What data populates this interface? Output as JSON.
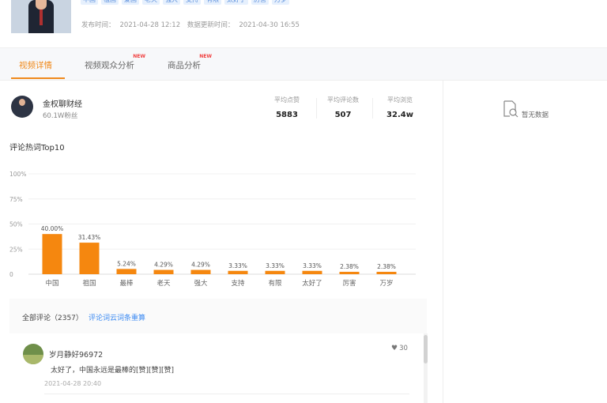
{
  "video": {
    "tags": [
      "中国",
      "祖国",
      "爱国",
      "老天",
      "强大",
      "支持",
      "有限",
      "太好了",
      "厉害",
      "万岁"
    ],
    "publish_label": "发布时间：",
    "publish_time": "2021-04-28 12:12",
    "update_label": "数据更新时间：",
    "update_time": "2021-04-30 16:55"
  },
  "tabs": [
    {
      "label": "视频详情",
      "active": true,
      "new": ""
    },
    {
      "label": "视频观众分析",
      "active": false,
      "new": "NEW"
    },
    {
      "label": "商品分析",
      "active": false,
      "new": "NEW"
    }
  ],
  "author": {
    "name": "金权聊财经",
    "fans": "60.1W粉丝"
  },
  "stats": [
    {
      "label": "平均点赞",
      "value": "5883"
    },
    {
      "label": "平均评论数",
      "value": "507"
    },
    {
      "label": "平均浏览",
      "value": "32.4w"
    }
  ],
  "chart_section": {
    "title": "评论热词Top10"
  },
  "chart_data": {
    "type": "bar",
    "categories": [
      "中国",
      "祖国",
      "最棒",
      "老天",
      "强大",
      "支持",
      "有限",
      "太好了",
      "厉害",
      "万岁"
    ],
    "values": [
      40.0,
      31.43,
      5.24,
      4.29,
      4.29,
      3.33,
      3.33,
      3.33,
      2.38,
      2.38
    ],
    "data_labels": [
      "40.00%",
      "31.43%",
      "5.24%",
      "4.29%",
      "4.29%",
      "3.33%",
      "3.33%",
      "3.33%",
      "2.38%",
      "2.38%"
    ],
    "ytick_labels": [
      "0",
      "25%",
      "50%",
      "75%",
      "100%"
    ],
    "yticks": [
      0,
      25,
      50,
      75,
      100
    ],
    "ylim": [
      0,
      100
    ],
    "bar_color": "#f5870f",
    "grid": true
  },
  "empty_state": {
    "icon": "search-document-icon",
    "text": "暂无数据"
  },
  "comments": {
    "title": "全部评论（2357）",
    "link": "评论词云词条重算",
    "items": [
      {
        "user": "岁月静好96972",
        "text": "太好了，中国永远是最棒的[赞][赞][赞]",
        "time": "2021-04-28 20:40",
        "likes": "30"
      }
    ]
  },
  "colors": {
    "accent": "#f08a1c",
    "link": "#3d8bf2",
    "tag_bg": "#e6f0fd"
  }
}
